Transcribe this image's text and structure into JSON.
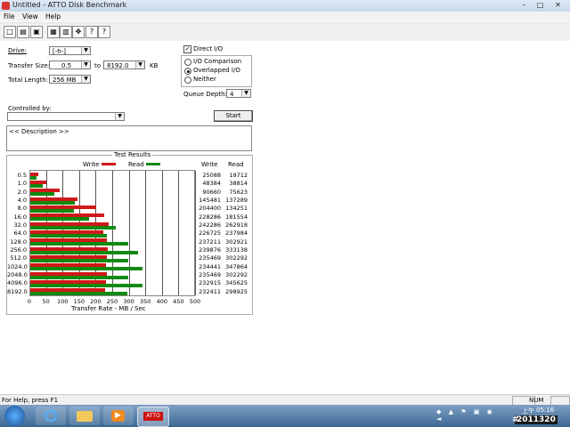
{
  "window": {
    "title": "Untitled - ATTO Disk Benchmark",
    "minimize": "–",
    "maximize": "□",
    "close": "✕"
  },
  "menu": [
    "File",
    "View",
    "Help"
  ],
  "toolbar": {
    "new": "□",
    "open": "▤",
    "save": "▣",
    "print": "▦",
    "preview": "▥",
    "move": "✥",
    "help": "?",
    "context_help": "?"
  },
  "form": {
    "drive_label": "Drive:",
    "drive_value": "[-h-]",
    "transfer_size_label": "Transfer Size:",
    "transfer_from": "0.5",
    "to_label": "to",
    "transfer_to": "8192.0",
    "kb_label": "KB",
    "total_length_label": "Total Length:",
    "total_length_value": "256 MB",
    "direct_io_label": "Direct I/O",
    "direct_io_checked": "✓",
    "io_comparison_label": "I/O Comparison",
    "overlapped_io_label": "Overlapped I/O",
    "neither_label": "Neither",
    "queue_depth_label": "Queue Depth:",
    "queue_depth_value": "4",
    "controlled_by_label": "Controlled by:",
    "controlled_by_value": "",
    "start_button": "Start",
    "description": "<< Description >>"
  },
  "chart_data": {
    "type": "bar",
    "title": "Test Results",
    "legend": {
      "write": "Write",
      "read": "Read"
    },
    "colors": {
      "write": "#d01818",
      "read": "#118a11"
    },
    "xlabel": "Transfer Rate - MB / Sec",
    "xlim": [
      0,
      500
    ],
    "xticks": [
      "0",
      "50",
      "100",
      "150",
      "200",
      "250",
      "300",
      "350",
      "400",
      "450",
      "500"
    ],
    "col_write": "Write",
    "col_read": "Read",
    "categories": [
      "0.5",
      "1.0",
      "2.0",
      "4.0",
      "8.0",
      "16.0",
      "32.0",
      "64.0",
      "128.0",
      "256.0",
      "512.0",
      "1024.0",
      "2048.0",
      "4096.0",
      "8192.0"
    ],
    "series": [
      {
        "name": "Write",
        "values": [
          25088,
          48384,
          90660,
          145481,
          204400,
          228286,
          242286,
          226725,
          237211,
          239876,
          235469,
          234441,
          235469,
          232915,
          232411
        ]
      },
      {
        "name": "Read",
        "values": [
          19712,
          38814,
          75623,
          137289,
          134251,
          181554,
          262918,
          237984,
          302921,
          333138,
          302292,
          347864,
          302292,
          345625,
          298925
        ]
      }
    ]
  },
  "status": {
    "help_text": "For Help, press F1",
    "num": "NUM"
  },
  "taskbar": {
    "clock_time": "05:16",
    "clock_ampm": "上午",
    "clock_date": "2011320",
    "atto_label": "ATTO"
  }
}
